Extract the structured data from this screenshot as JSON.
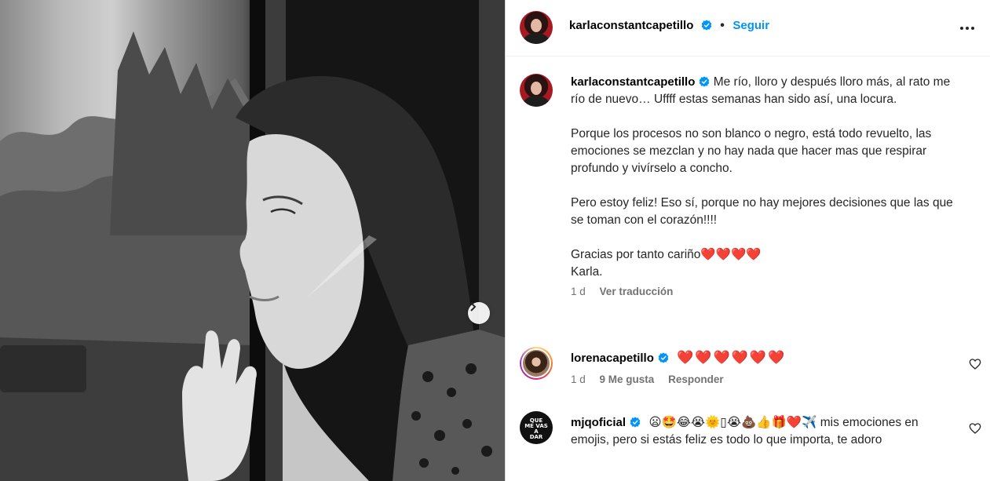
{
  "post": {
    "author": "karlaconstantcapetillo",
    "follow_label": "Seguir",
    "separator": "•"
  },
  "caption": {
    "author": "karlaconstantcapetillo",
    "para1": "Me río, lloro y después lloro más, al rato me río de nuevo… Uffff estas semanas han sido así, una locura.",
    "para2": "Porque los procesos no son blanco o negro, está todo revuelto, las emociones se mezclan y no hay nada que hacer mas que respirar profundo y vivírselo a concho.",
    "para3": "Pero estoy feliz! Eso sí, porque no hay mejores decisiones que las que se toman con el corazón!!!!",
    "para4_line1": "Gracias por tanto cariño❤️❤️❤️❤️",
    "para4_line2": "Karla.",
    "time": "1 d",
    "translate": "Ver traducción"
  },
  "comments": [
    {
      "author": "lorenacapetillo",
      "text": "❤️❤️❤️❤️❤️❤️",
      "time": "1 d",
      "likes": "9 Me gusta",
      "reply": "Responder"
    },
    {
      "author": "mjqoficial",
      "emojis": "😦🤩😂😭🌞▯😭💩👍🎁❤️✈️",
      "text": " mis emociones en emojis, pero si estás feliz es todo lo que importa, te adoro",
      "avatar_text": [
        "QUE",
        "ME VAS",
        "A",
        "DAR"
      ]
    }
  ],
  "icons": {
    "verified": "verified-badge-icon",
    "more": "more-options-icon",
    "like": "heart-outline-icon",
    "next": "chevron-right-icon"
  },
  "colors": {
    "accent": "#0095f6",
    "verified": "#0095f6",
    "meta_text": "#737373",
    "heart": "#e0181f"
  }
}
